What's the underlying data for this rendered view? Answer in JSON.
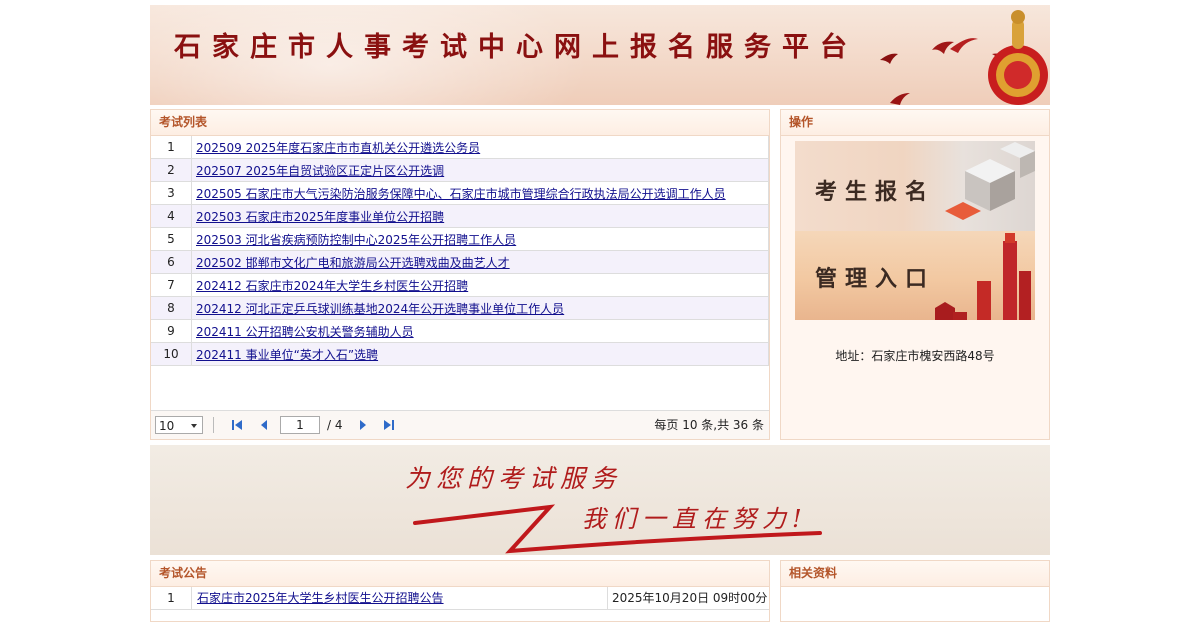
{
  "header": {
    "title": "石家庄市人事考试中心网上报名服务平台"
  },
  "exam_list": {
    "title": "考试列表",
    "rows": [
      {
        "no": "1",
        "name": "202509 2025年度石家庄市市直机关公开遴选公务员"
      },
      {
        "no": "2",
        "name": "202507 2025年自贸试验区正定片区公开选调"
      },
      {
        "no": "3",
        "name": "202505 石家庄市大气污染防治服务保障中心、石家庄市城市管理综合行政执法局公开选调工作人员"
      },
      {
        "no": "4",
        "name": "202503 石家庄市2025年度事业单位公开招聘"
      },
      {
        "no": "5",
        "name": "202503 河北省疾病预防控制中心2025年公开招聘工作人员"
      },
      {
        "no": "6",
        "name": "202502 邯郸市文化广电和旅游局公开选聘戏曲及曲艺人才"
      },
      {
        "no": "7",
        "name": "202412 石家庄市2024年大学生乡村医生公开招聘"
      },
      {
        "no": "8",
        "name": "202412 河北正定乒乓球训练基地2024年公开选聘事业单位工作人员"
      },
      {
        "no": "9",
        "name": "202411 公开招聘公安机关警务辅助人员"
      },
      {
        "no": "10",
        "name": "202411 事业单位“英才入石”选聘"
      }
    ],
    "pager": {
      "page_size": "10",
      "current_page": "1",
      "total_pages": "/ 4",
      "summary": "每页 10 条,共 36 条"
    }
  },
  "operations": {
    "title": "操作",
    "register_label": "考生报名",
    "manage_label": "管理入口",
    "address": "地址：石家庄市槐安西路48号"
  },
  "slogan": {
    "line1": "为您的考试服务",
    "line2": "我们一直在努力!"
  },
  "notices": {
    "title": "考试公告",
    "rows": [
      {
        "no": "1",
        "title": "石家庄市2025年大学生乡村医生公开招聘公告",
        "date": "2025年10月20日 09时00分"
      }
    ]
  },
  "resources": {
    "title": "相关资料"
  },
  "colors": {
    "title_red": "#8a1010",
    "link_blue": "#12108e",
    "panel_head": "#b4552a"
  }
}
